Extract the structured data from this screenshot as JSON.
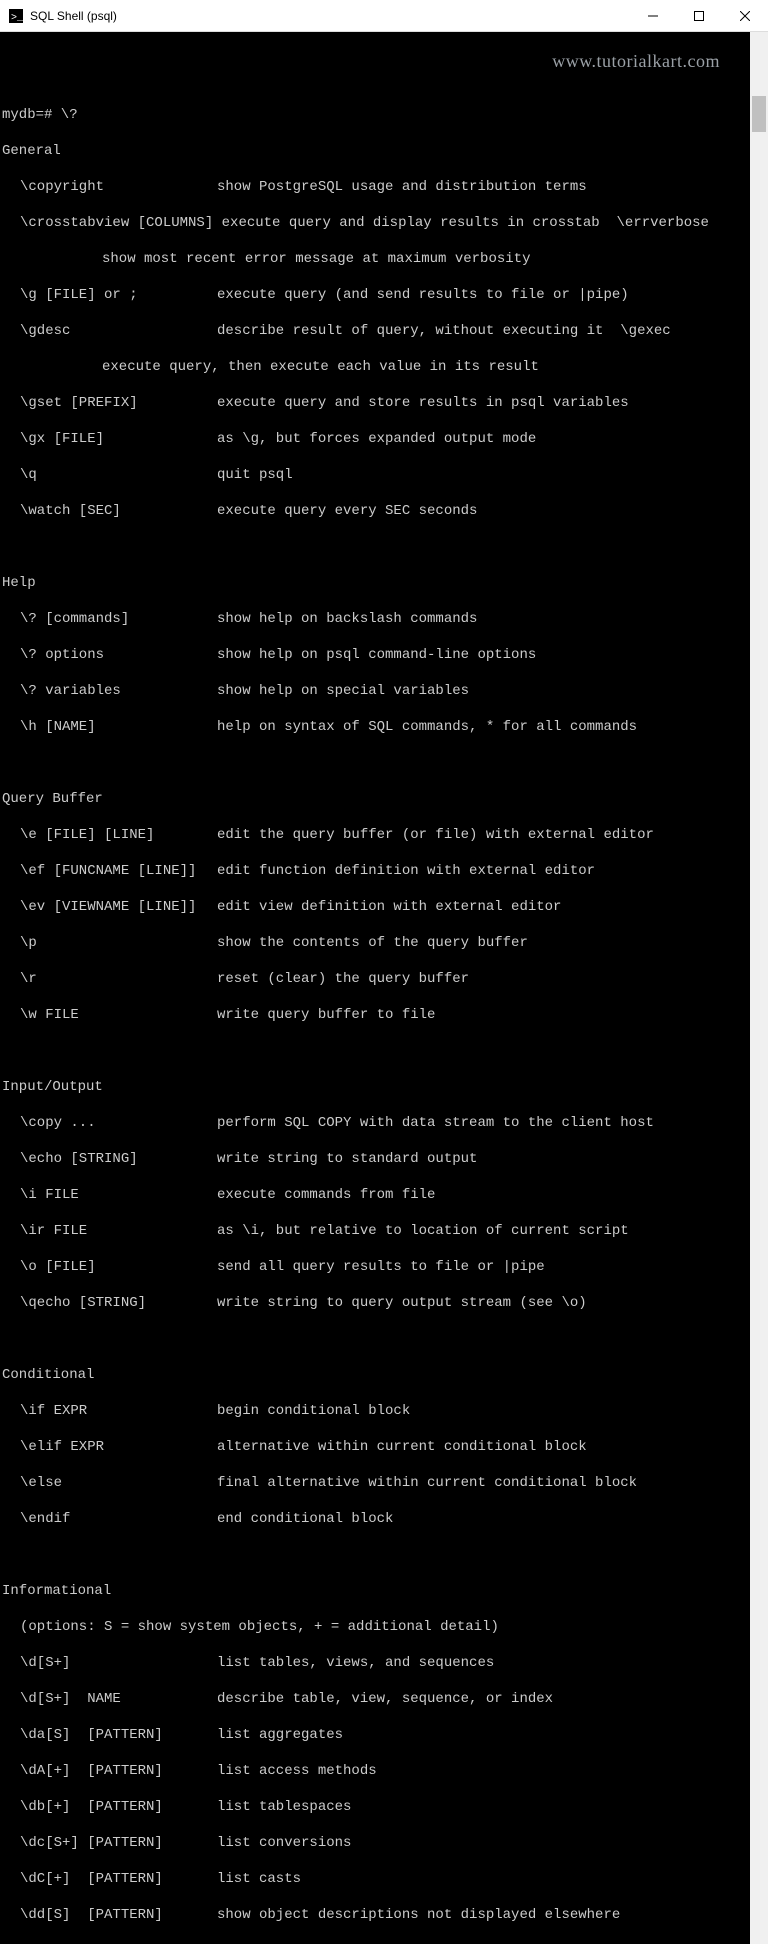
{
  "window": {
    "title": "SQL Shell (psql)"
  },
  "watermark": "www.tutorialkart.com",
  "prompt": "mydb=# \\?",
  "sections": {
    "general": {
      "title": "General",
      "items": {
        "copyright_cmd": "\\copyright",
        "copyright_desc": "show PostgreSQL usage and distribution terms",
        "crosstab_cmd": "\\crosstabview [COLUMNS]",
        "crosstab_desc": "execute query and display results in crosstab",
        "errverbose_cmd": "\\errverbose",
        "errverbose_desc": "show most recent error message at maximum verbosity",
        "g_cmd": "\\g [FILE] or ;",
        "g_desc": "execute query (and send results to file or |pipe)",
        "gdesc_cmd": "\\gdesc",
        "gdesc_desc": "describe result of query, without executing it",
        "gexec_cmd": "\\gexec",
        "gexec_desc": "execute query, then execute each value in its result",
        "gset_cmd": "\\gset [PREFIX]",
        "gset_desc": "execute query and store results in psql variables",
        "gx_cmd": "\\gx [FILE]",
        "gx_desc": "as \\g, but forces expanded output mode",
        "q_cmd": "\\q",
        "q_desc": "quit psql",
        "watch_cmd": "\\watch [SEC]",
        "watch_desc": "execute query every SEC seconds"
      }
    },
    "help": {
      "title": "Help",
      "items": {
        "cmds_cmd": "\\? [commands]",
        "cmds_desc": "show help on backslash commands",
        "opts_cmd": "\\? options",
        "opts_desc": "show help on psql command-line options",
        "vars_cmd": "\\? variables",
        "vars_desc": "show help on special variables",
        "h_cmd": "\\h [NAME]",
        "h_desc": "help on syntax of SQL commands, * for all commands"
      }
    },
    "querybuffer": {
      "title": "Query Buffer",
      "items": {
        "e_cmd": "\\e [FILE] [LINE]",
        "e_desc": "edit the query buffer (or file) with external editor",
        "ef_cmd": "\\ef [FUNCNAME [LINE]]",
        "ef_desc": "edit function definition with external editor",
        "ev_cmd": "\\ev [VIEWNAME [LINE]]",
        "ev_desc": "edit view definition with external editor",
        "p_cmd": "\\p",
        "p_desc": "show the contents of the query buffer",
        "r_cmd": "\\r",
        "r_desc": "reset (clear) the query buffer",
        "w_cmd": "\\w FILE",
        "w_desc": "write query buffer to file"
      }
    },
    "io": {
      "title": "Input/Output",
      "items": {
        "copy_cmd": "\\copy ...",
        "copy_desc": "perform SQL COPY with data stream to the client host",
        "echo_cmd": "\\echo [STRING]",
        "echo_desc": "write string to standard output",
        "i_cmd": "\\i FILE",
        "i_desc": "execute commands from file",
        "ir_cmd": "\\ir FILE",
        "ir_desc": "as \\i, but relative to location of current script",
        "o_cmd": "\\o [FILE]",
        "o_desc": "send all query results to file or |pipe",
        "qecho_cmd": "\\qecho [STRING]",
        "qecho_desc": "write string to query output stream (see \\o)"
      }
    },
    "conditional": {
      "title": "Conditional",
      "items": {
        "if_cmd": "\\if EXPR",
        "if_desc": "begin conditional block",
        "elif_cmd": "\\elif EXPR",
        "elif_desc": "alternative within current conditional block",
        "else_cmd": "\\else",
        "else_desc": "final alternative within current conditional block",
        "endif_cmd": "\\endif",
        "endif_desc": "end conditional block"
      }
    },
    "informational": {
      "title": "Informational",
      "note": "(options: S = show system objects, + = additional detail)",
      "items": {
        "d_cmd": "\\d[S+]",
        "d_desc": "list tables, views, and sequences",
        "dname_cmd": "\\d[S+]  NAME",
        "dname_desc": "describe table, view, sequence, or index",
        "da_cmd": "\\da[S]  [PATTERN]",
        "da_desc": "list aggregates",
        "dA_cmd": "\\dA[+]  [PATTERN]",
        "dA_desc": "list access methods",
        "db_cmd": "\\db[+]  [PATTERN]",
        "db_desc": "list tablespaces",
        "dc_cmd": "\\dc[S+] [PATTERN]",
        "dc_desc": "list conversions",
        "dC_cmd": "\\dC[+]  [PATTERN]",
        "dC_desc": "list casts",
        "dd_cmd": "\\dd[S]  [PATTERN]",
        "dd_desc": "show object descriptions not displayed elsewhere"
      }
    }
  }
}
